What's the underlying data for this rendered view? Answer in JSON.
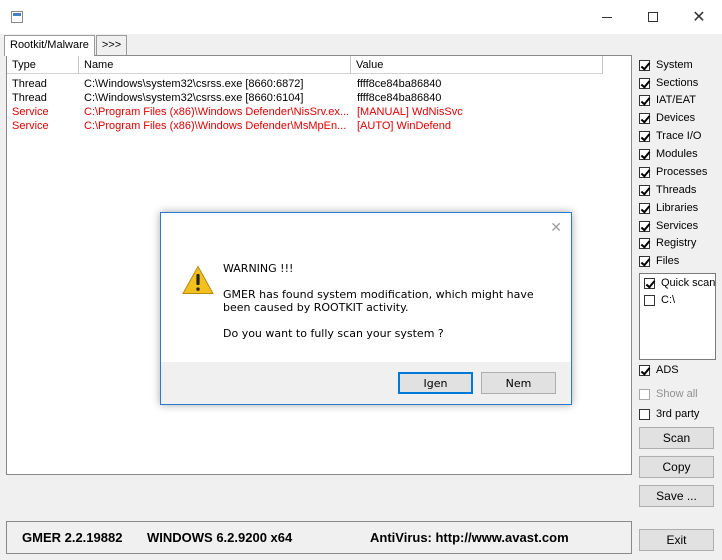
{
  "window": {
    "minimize": "—",
    "maximize": "",
    "close": "✕"
  },
  "tabs": [
    {
      "label": "Rootkit/Malware"
    },
    {
      "label": ">>>"
    }
  ],
  "table": {
    "headers": {
      "type": "Type",
      "name": "Name",
      "value": "Value"
    },
    "rows": [
      {
        "type": "Thread",
        "name": "C:\\Windows\\system32\\csrss.exe [8660:6872]",
        "value": "ffff8ce84ba86840",
        "color": "#000000"
      },
      {
        "type": "Thread",
        "name": "C:\\Windows\\system32\\csrss.exe [8660:6104]",
        "value": "ffff8ce84ba86840",
        "color": "#000000"
      },
      {
        "type": "Service",
        "name": "C:\\Program Files (x86)\\Windows Defender\\NisSrv.ex...",
        "value": "[MANUAL] WdNisSvc",
        "color": "#e00000"
      },
      {
        "type": "Service",
        "name": "C:\\Program Files (x86)\\Windows Defender\\MsMpEn...",
        "value": "[AUTO] WinDefend",
        "color": "#e00000"
      }
    ]
  },
  "options": {
    "checks": [
      {
        "label": "System",
        "checked": true
      },
      {
        "label": "Sections",
        "checked": true
      },
      {
        "label": "IAT/EAT",
        "checked": true
      },
      {
        "label": "Devices",
        "checked": true
      },
      {
        "label": "Trace I/O",
        "checked": true
      },
      {
        "label": "Modules",
        "checked": true
      },
      {
        "label": "Processes",
        "checked": true
      },
      {
        "label": "Threads",
        "checked": true
      },
      {
        "label": "Libraries",
        "checked": true
      },
      {
        "label": "Services",
        "checked": true
      },
      {
        "label": "Registry",
        "checked": true
      },
      {
        "label": "Files",
        "checked": true
      }
    ],
    "scan_targets": [
      {
        "label": "Quick scan",
        "checked": true
      },
      {
        "label": "C:\\",
        "checked": false
      }
    ],
    "ads": {
      "label": "ADS",
      "checked": true
    },
    "show_all": {
      "label": "Show all",
      "checked": false,
      "disabled": true
    },
    "third_party": {
      "label": "3rd party",
      "checked": false
    }
  },
  "buttons": {
    "scan": "Scan",
    "copy": "Copy",
    "save": "Save ...",
    "exit": "Exit"
  },
  "status": {
    "version": "GMER 2.2.19882",
    "os": "WINDOWS 6.2.9200  x64",
    "antivirus": "AntiVirus: http://www.avast.com"
  },
  "dialog": {
    "close": "✕",
    "heading": "WARNING !!!",
    "message": "GMER has found system modification, which might have been caused by ROOTKIT activity.",
    "question": "Do you want to fully scan your system  ?",
    "yes_label": "Igen",
    "no_label": "Nem"
  },
  "colors": {
    "dialog_border": "#2b78d0",
    "alert_red": "#e00000",
    "warning_yellow": "#f4c01e"
  }
}
